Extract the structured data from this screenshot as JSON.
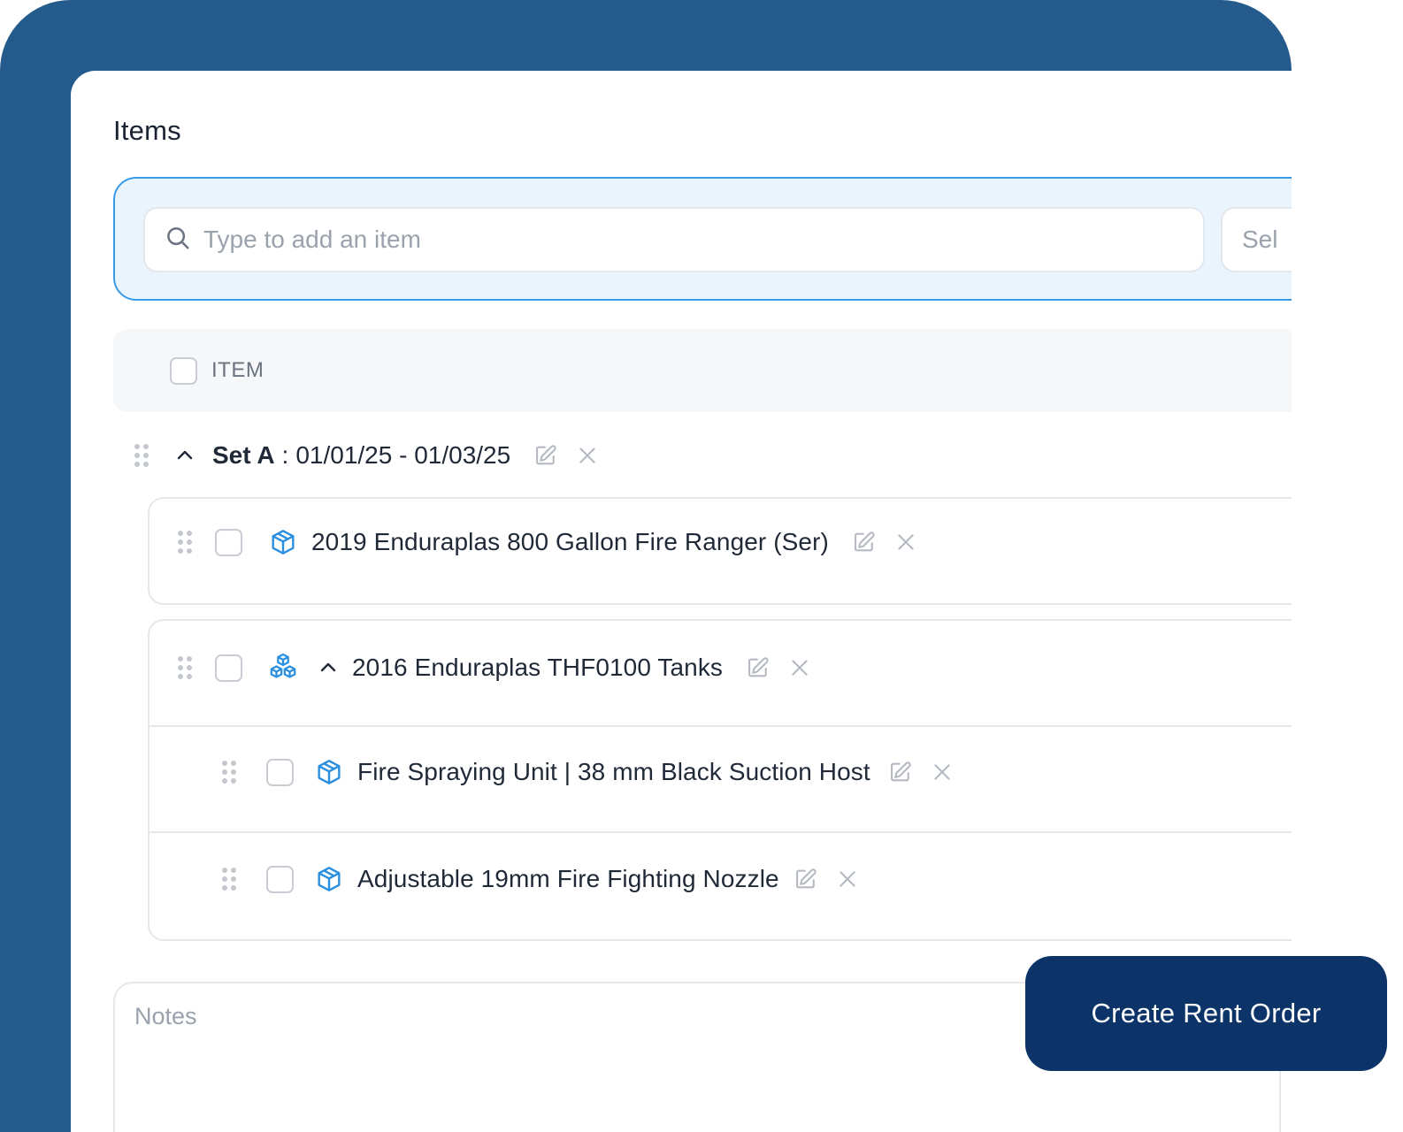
{
  "section": {
    "title": "Items"
  },
  "search": {
    "placeholder": "Type to add an item",
    "select_placeholder": "Sel"
  },
  "table": {
    "header": {
      "item_label": "ITEM"
    }
  },
  "set": {
    "name": "Set A",
    "separator": ":",
    "dates": "01/01/25 - 01/03/25"
  },
  "items": [
    {
      "label": "2019 Enduraplas 800 Gallon Fire Ranger (Ser)",
      "type": "single",
      "icon": "box-icon"
    },
    {
      "label": "2016 Enduraplas THF0100 Tanks",
      "type": "bundle",
      "icon": "boxes-icon",
      "expanded": true,
      "children": [
        {
          "label": "Fire Spraying Unit | 38 mm Black Suction Host",
          "icon": "box-icon"
        },
        {
          "label": "Adjustable 19mm Fire Fighting Nozzle",
          "icon": "box-icon"
        }
      ]
    }
  ],
  "notes": {
    "placeholder": "Notes"
  },
  "actions": {
    "create_label": "Create Rent Order"
  },
  "colors": {
    "frame": "#245a8c",
    "accent": "#3b9ae6",
    "cta": "#0c3468",
    "icon_blue": "#2b8fe0"
  }
}
